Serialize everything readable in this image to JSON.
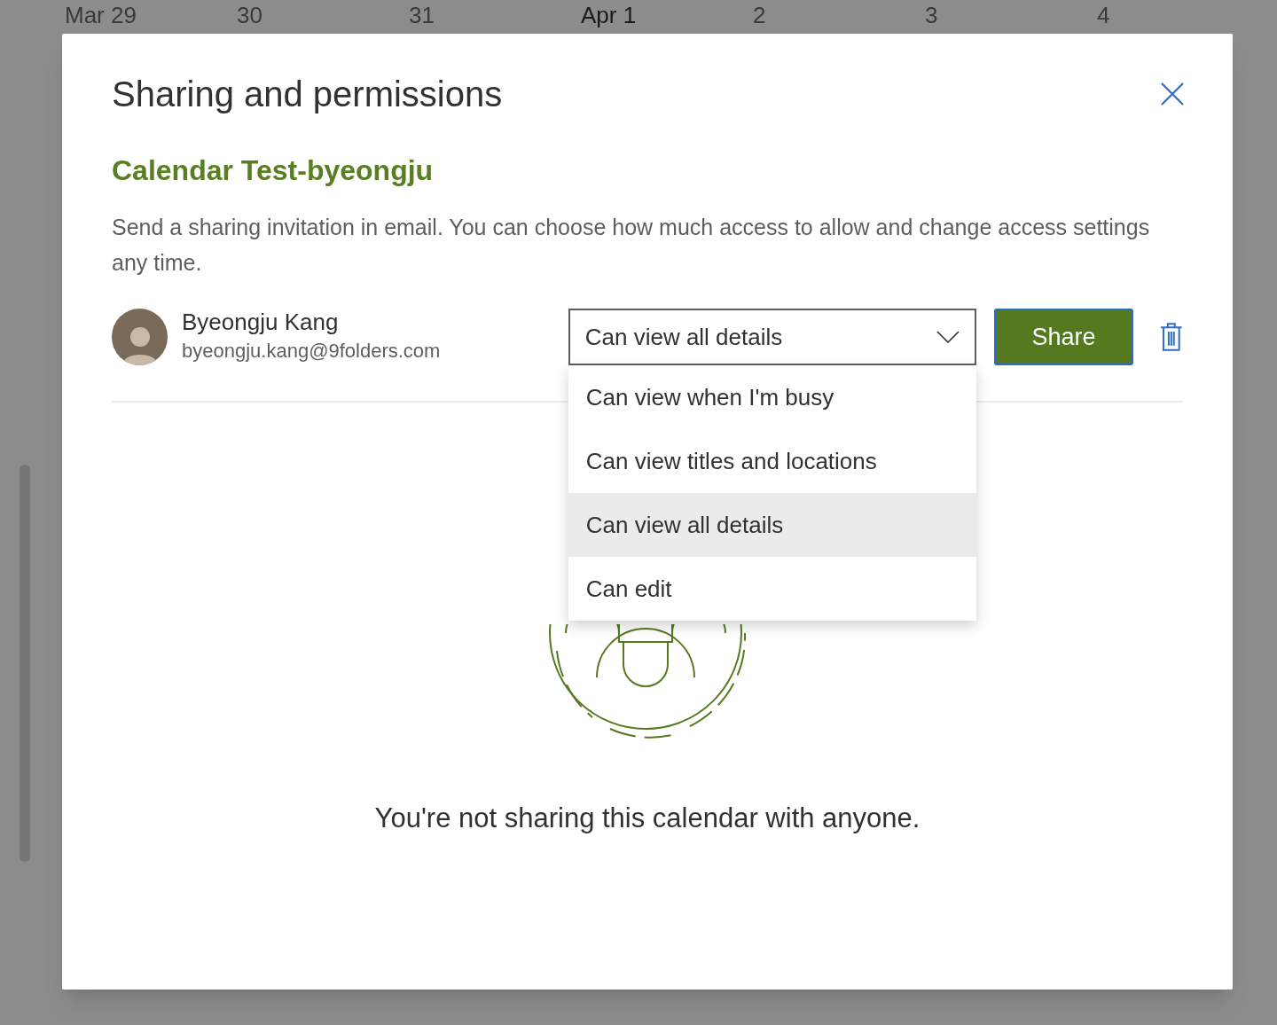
{
  "calendar_header": {
    "dates": [
      {
        "label": "Mar 29",
        "selected": false
      },
      {
        "label": "30",
        "selected": false
      },
      {
        "label": "31",
        "selected": false
      },
      {
        "label": "Apr 1",
        "selected": true
      },
      {
        "label": "2",
        "selected": false
      },
      {
        "label": "3",
        "selected": false
      },
      {
        "label": "4",
        "selected": false
      }
    ]
  },
  "dialog": {
    "title": "Sharing and permissions",
    "calendar_name": "Calendar Test-byeongju",
    "description": "Send a sharing invitation in email. You can choose how much access to allow and change access settings any time.",
    "invitee": {
      "name": "Byeongju Kang",
      "email": "byeongju.kang@9folders.com"
    },
    "permission_select": {
      "value": "Can view all details",
      "expanded": true
    },
    "permission_options": [
      {
        "label": "Can view when I'm busy",
        "selected": false
      },
      {
        "label": "Can view titles and locations",
        "selected": false
      },
      {
        "label": "Can view all details",
        "selected": true
      },
      {
        "label": "Can edit",
        "selected": false
      }
    ],
    "share_button": "Share",
    "empty_message": "You're not sharing this calendar with anyone."
  }
}
